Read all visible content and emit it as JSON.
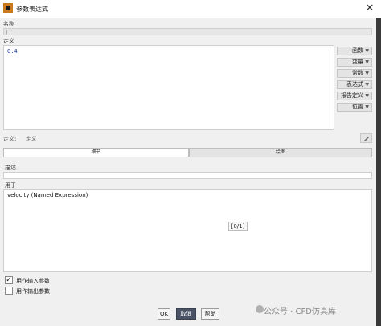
{
  "window": {
    "title": "参数表达式",
    "close_glyph": "✕"
  },
  "name_field": {
    "label": "名称",
    "value": "J"
  },
  "definition": {
    "label": "定义",
    "value": "0.4",
    "side_buttons": [
      {
        "label": "函数",
        "icon": "chevron-down-icon"
      },
      {
        "label": "变量",
        "icon": "chevron-down-icon"
      },
      {
        "label": "常数",
        "icon": "chevron-down-icon"
      },
      {
        "label": "表达式",
        "icon": "chevron-down-icon"
      },
      {
        "label": "报告定义",
        "icon": "chevron-down-icon"
      },
      {
        "label": "位置",
        "icon": "chevron-down-icon"
      }
    ],
    "bottom_label": "定义:",
    "bottom_value": "定义",
    "icon_button": "sketch-icon"
  },
  "tabs": [
    {
      "label": "细节",
      "active": true
    },
    {
      "label": "绘图",
      "active": false
    }
  ],
  "description": {
    "label": "描述",
    "value": ""
  },
  "used_in": {
    "label": "用于",
    "items": [
      "velocity (Named Expression)"
    ]
  },
  "page_indicator": "[0/1]",
  "options": [
    {
      "label": "用作输入参数",
      "checked": true
    },
    {
      "label": "用作输出参数",
      "checked": false
    }
  ],
  "buttons": {
    "ok": "OK",
    "cancel": "取消",
    "help": "帮助"
  },
  "watermark": "公众号 · CFD仿真库",
  "colors": {
    "cancel_bg": "#4a5466",
    "definition_text": "#1a3aa0"
  }
}
